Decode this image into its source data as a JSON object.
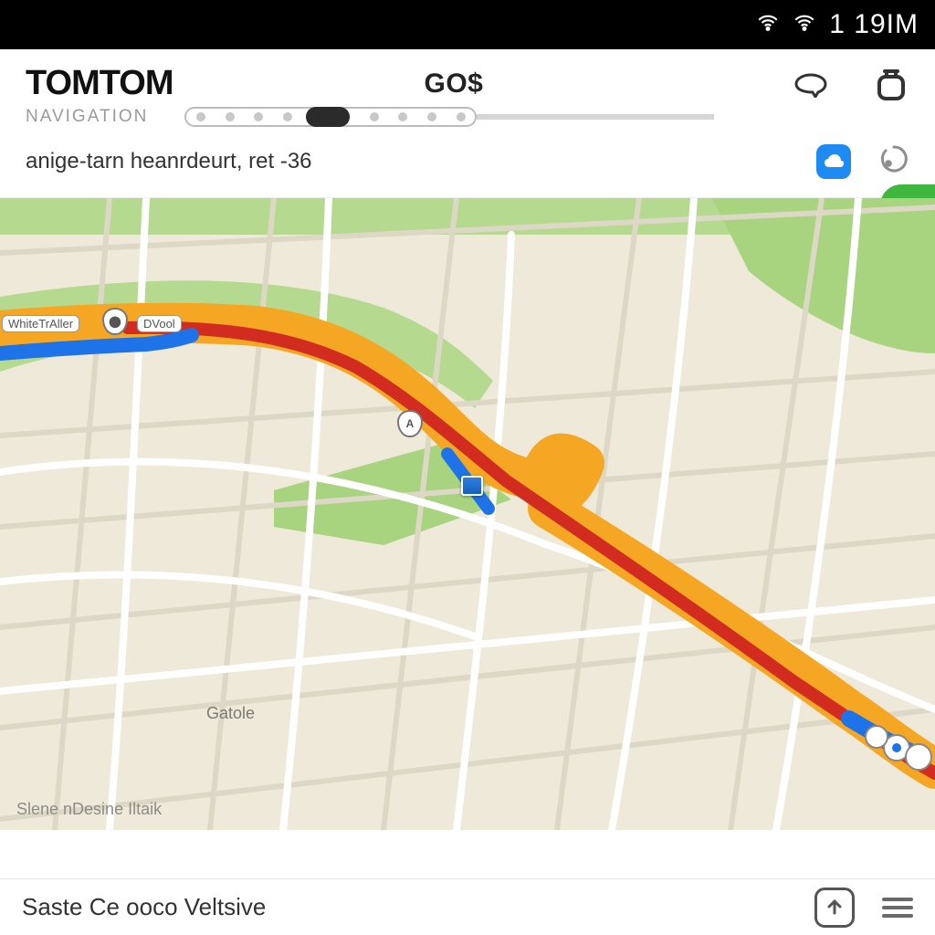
{
  "status": {
    "clock": "1 19IM"
  },
  "header": {
    "brand": "TOMTOM",
    "go_label": "GO$",
    "subtitle": "NAVIGATION",
    "address": "anige-tarn heanrdeurt, ret -36"
  },
  "map": {
    "labels": {
      "left_road_1": "WhiteTrAller",
      "left_road_2": "DVool",
      "poi_1": "Gatole",
      "shield_1": "A"
    },
    "attribution": "Slene  nDesine  Iltaik"
  },
  "footer": {
    "text": "Saste Ce ooco Veltsive"
  },
  "colors": {
    "route_outer": "#f5a623",
    "route_inner": "#d12c1f",
    "alt_route": "#1f73e8",
    "park": "#b5d98f",
    "park2": "#a8d47f"
  }
}
